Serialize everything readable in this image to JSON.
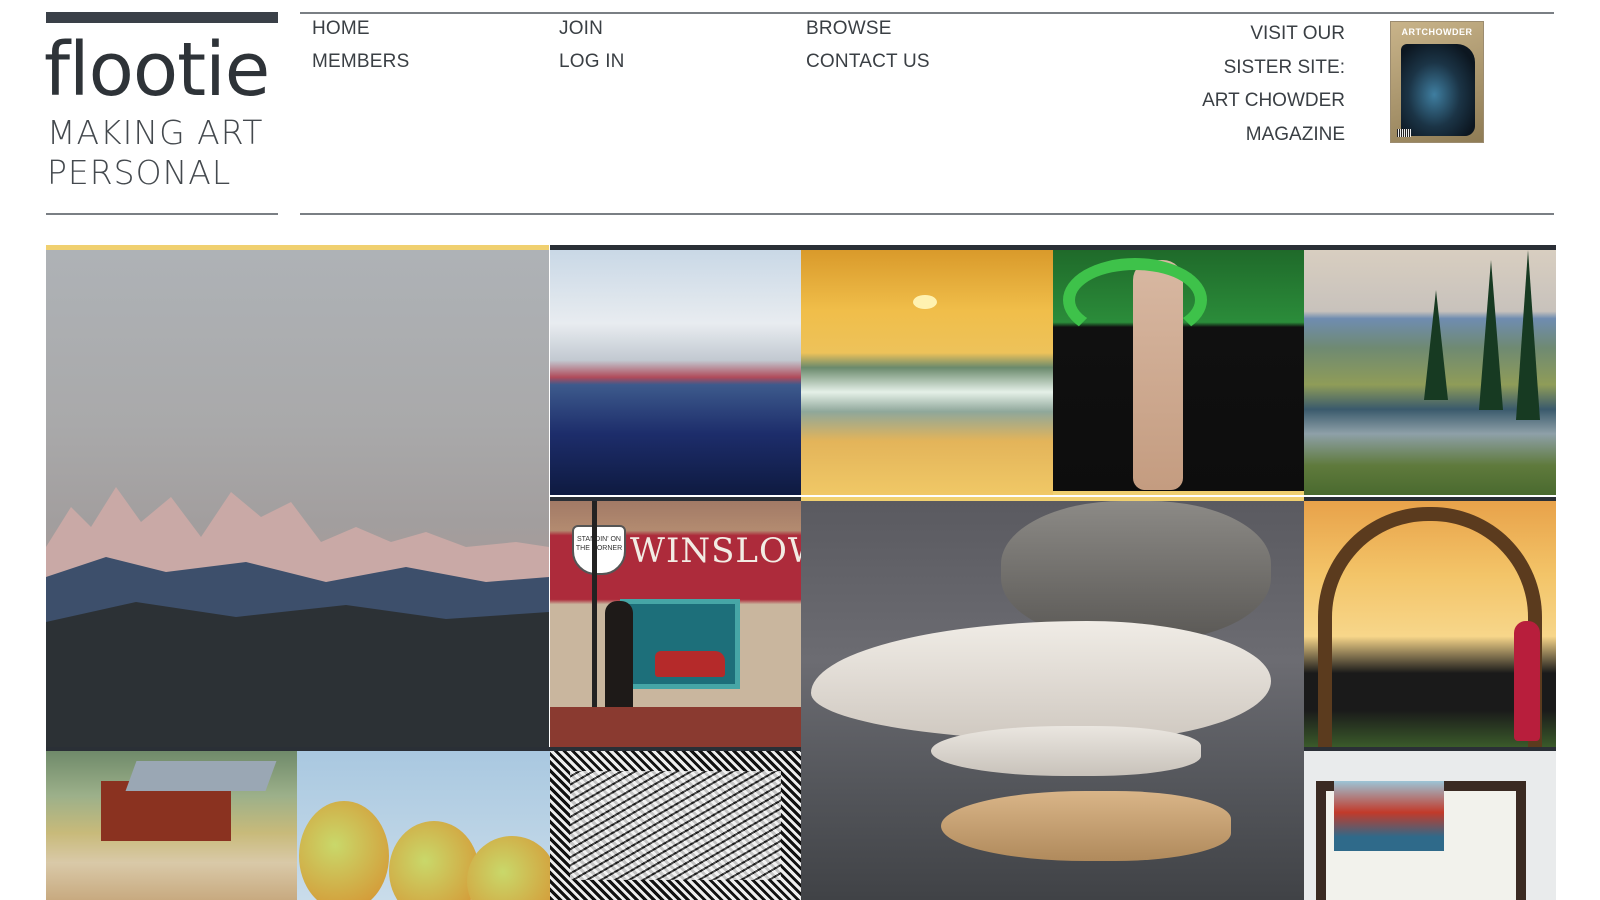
{
  "logo": {
    "wordmark": "flootie",
    "tagline_line1": "MAKING ART",
    "tagline_line2": "PERSONAL"
  },
  "nav": {
    "home": "HOME",
    "members": "MEMBERS",
    "join": "JOIN",
    "login": "LOG IN",
    "browse": "BROWSE",
    "contact": "CONTACT US"
  },
  "sister_site": {
    "line1": "VISIT OUR",
    "line2": "SISTER SITE:",
    "line3": "ART CHOWDER",
    "line4": "MAGAZINE",
    "magazine_cover_title": "ARTCHOWDER"
  },
  "gallery": {
    "tiles": [
      {
        "subject": "mountain-landscape"
      },
      {
        "subject": "city-skyline-harbor"
      },
      {
        "subject": "ocean-sunset"
      },
      {
        "subject": "figure-with-snake-and-roots"
      },
      {
        "subject": "forest-river"
      },
      {
        "subject": "winslow-street-corner",
        "sign_text": "WINSLOW",
        "shield_text": "STANDIN' ON THE CORNER"
      },
      {
        "subject": "carved-wooden-fish"
      },
      {
        "subject": "sunset-arch-silhouette"
      },
      {
        "subject": "barn-landscape"
      },
      {
        "subject": "pears"
      },
      {
        "subject": "black-white-pattern"
      },
      {
        "subject": "framed-watercolor"
      }
    ]
  },
  "colors": {
    "text": "#3a3f44",
    "logo_bar": "#3a4048",
    "accent_highlight": "#f0d070",
    "tile_border": "#2a2f36"
  }
}
